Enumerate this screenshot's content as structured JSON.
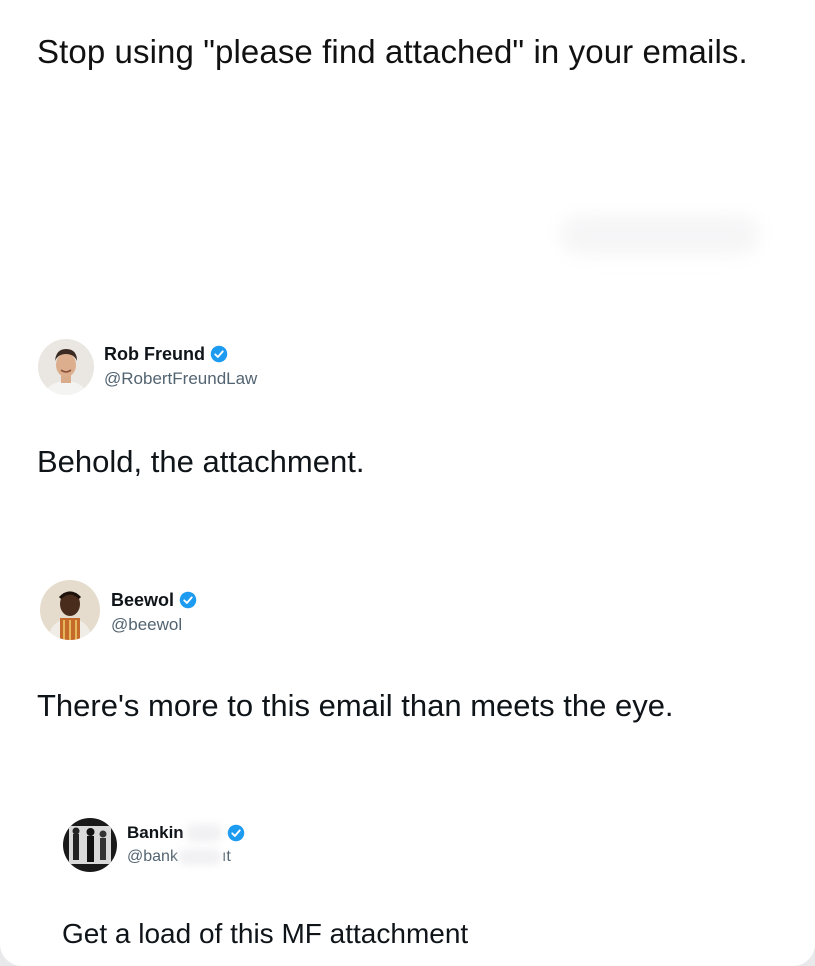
{
  "headline": "Stop using \"please find attached\" in your emails.",
  "posts": [
    {
      "name": "Rob Freund",
      "handle": "@RobertFreundLaw",
      "text": "Behold, the attachment.",
      "verified": true,
      "avatar_icon": "man-portrait-avatar"
    },
    {
      "name": "Beewol",
      "handle": "@beewol",
      "text": "There's more to this email than meets the eye.",
      "verified": true,
      "avatar_icon": "man-portrait-avatar"
    },
    {
      "name": "Bankin",
      "handle": "@bank",
      "handle_tail": "ıt",
      "text": "Get a load of this MF attachment",
      "verified": true,
      "avatar_icon": "bw-figures-avatar"
    }
  ],
  "colors": {
    "background": "#ffffff",
    "verified_badge": "#1d9bf0",
    "handle_gray": "#536471",
    "text": "#0f1419"
  }
}
